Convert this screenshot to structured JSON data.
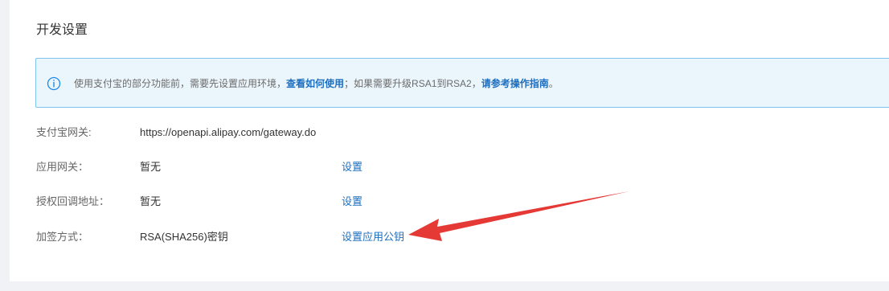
{
  "section": {
    "title": "开发设置"
  },
  "notice": {
    "text_before": "使用支付宝的部分功能前，需要先设置应用环境，",
    "link1": "查看如何使用",
    "text_middle": "；如果需要升级RSA1到RSA2，",
    "link2": "请参考操作指南",
    "text_end": "。"
  },
  "settings": [
    {
      "label": "支付宝网关:",
      "value": "https://openapi.alipay.com/gateway.do",
      "action": ""
    },
    {
      "label": "应用网关：",
      "value": "暂无",
      "action": "设置"
    },
    {
      "label": "授权回调地址：",
      "value": "暂无",
      "action": "设置"
    },
    {
      "label": "加签方式：",
      "value": "RSA(SHA256)密钥",
      "action": "设置应用公钥"
    }
  ],
  "colors": {
    "link": "#1e6fbf",
    "arrow": "#e53935",
    "notice_bg": "#ebf5fc",
    "notice_border": "#7ec4ee"
  },
  "icons": {
    "notice": "info-circle-icon",
    "annotation": "red-arrow-icon"
  }
}
